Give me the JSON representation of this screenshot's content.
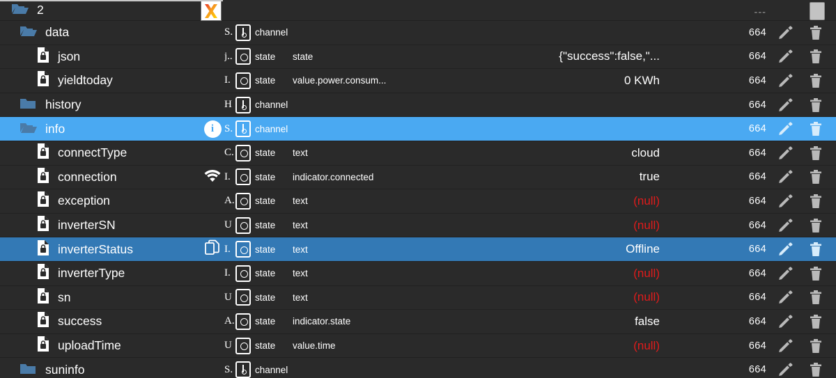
{
  "header": {
    "root_label": "2",
    "folder_icon": "folder-open-icon",
    "logo_icon": "x-logo-icon",
    "dashes": "---",
    "delete_icon": "trash-icon"
  },
  "columns": {
    "perm_value": "664",
    "edit_icon": "pencil-icon",
    "delete_icon": "trash-icon"
  },
  "colors": {
    "background": "#2a2a2a",
    "selection": "#4aa9f2",
    "selection_dark": "#3379b5",
    "null_text": "#e01b1b",
    "folder": "#4a7ba8",
    "text": "#ffffff"
  },
  "rows": [
    {
      "name": "data",
      "icon": "folder-open-icon",
      "indent": 1,
      "type_letter": "S.",
      "type_kind": "channel",
      "type_word": "channel",
      "role": "",
      "value": "",
      "value_null": false,
      "perm": "664",
      "badge": "",
      "selected": "none"
    },
    {
      "name": "json",
      "icon": "file-lock-icon",
      "indent": 2,
      "type_letter": "j..",
      "type_kind": "state",
      "type_word": "state",
      "role": "state",
      "value": "{\"success\":false,\"...",
      "value_null": false,
      "perm": "664",
      "badge": "",
      "selected": "none"
    },
    {
      "name": "yieldtoday",
      "icon": "file-lock-icon",
      "indent": 2,
      "type_letter": "I.",
      "type_kind": "state",
      "type_word": "state",
      "role": "value.power.consum...",
      "value": "0 KWh",
      "value_null": false,
      "perm": "664",
      "badge": "",
      "selected": "none"
    },
    {
      "name": "history",
      "icon": "folder-closed-icon",
      "indent": 1,
      "type_letter": "H",
      "type_kind": "channel",
      "type_word": "channel",
      "role": "",
      "value": "",
      "value_null": false,
      "perm": "664",
      "badge": "",
      "selected": "none"
    },
    {
      "name": "info",
      "icon": "folder-open-icon",
      "indent": 1,
      "type_letter": "S.",
      "type_kind": "channel",
      "type_word": "channel",
      "role": "",
      "value": "",
      "value_null": false,
      "perm": "664",
      "badge": "info-icon",
      "selected": "light"
    },
    {
      "name": "connectType",
      "icon": "file-lock-icon",
      "indent": 2,
      "type_letter": "C.",
      "type_kind": "state",
      "type_word": "state",
      "role": "text",
      "value": "cloud",
      "value_null": false,
      "perm": "664",
      "badge": "",
      "selected": "none"
    },
    {
      "name": "connection",
      "icon": "file-lock-icon",
      "indent": 2,
      "type_letter": "I.",
      "type_kind": "state",
      "type_word": "state",
      "role": "indicator.connected",
      "value": "true",
      "value_null": false,
      "perm": "664",
      "badge": "wifi-icon",
      "selected": "none"
    },
    {
      "name": "exception",
      "icon": "file-lock-icon",
      "indent": 2,
      "type_letter": "A.",
      "type_kind": "state",
      "type_word": "state",
      "role": "text",
      "value": "(null)",
      "value_null": true,
      "perm": "664",
      "badge": "",
      "selected": "none"
    },
    {
      "name": "inverterSN",
      "icon": "file-lock-icon",
      "indent": 2,
      "type_letter": "U",
      "type_kind": "state",
      "type_word": "state",
      "role": "text",
      "value": "(null)",
      "value_null": true,
      "perm": "664",
      "badge": "",
      "selected": "none"
    },
    {
      "name": "inverterStatus",
      "icon": "file-lock-icon",
      "indent": 2,
      "type_letter": "I.",
      "type_kind": "state",
      "type_word": "state",
      "role": "text",
      "value": "Offline",
      "value_null": false,
      "perm": "664",
      "badge": "copy-icon",
      "selected": "dark"
    },
    {
      "name": "inverterType",
      "icon": "file-lock-icon",
      "indent": 2,
      "type_letter": "I.",
      "type_kind": "state",
      "type_word": "state",
      "role": "text",
      "value": "(null)",
      "value_null": true,
      "perm": "664",
      "badge": "",
      "selected": "none"
    },
    {
      "name": "sn",
      "icon": "file-lock-icon",
      "indent": 2,
      "type_letter": "U",
      "type_kind": "state",
      "type_word": "state",
      "role": "text",
      "value": "(null)",
      "value_null": true,
      "perm": "664",
      "badge": "",
      "selected": "none"
    },
    {
      "name": "success",
      "icon": "file-lock-icon",
      "indent": 2,
      "type_letter": "A.",
      "type_kind": "state",
      "type_word": "state",
      "role": "indicator.state",
      "value": "false",
      "value_null": false,
      "perm": "664",
      "badge": "",
      "selected": "none"
    },
    {
      "name": "uploadTime",
      "icon": "file-lock-icon",
      "indent": 2,
      "type_letter": "U",
      "type_kind": "state",
      "type_word": "state",
      "role": "value.time",
      "value": "(null)",
      "value_null": true,
      "perm": "664",
      "badge": "",
      "selected": "none"
    },
    {
      "name": "suninfo",
      "icon": "folder-closed-icon",
      "indent": 1,
      "type_letter": "S.",
      "type_kind": "channel",
      "type_word": "channel",
      "role": "",
      "value": "",
      "value_null": false,
      "perm": "664",
      "badge": "",
      "selected": "none"
    }
  ]
}
